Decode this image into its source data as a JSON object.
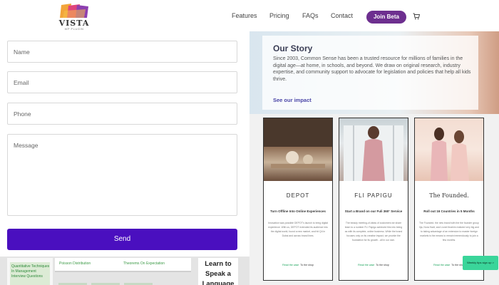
{
  "header": {
    "logo": {
      "name": "VISTA",
      "sub": "WP PLUGIN"
    },
    "nav": [
      "Features",
      "Pricing",
      "FAQs",
      "Contact"
    ],
    "cta": "Join Beta",
    "cart_icon": "cart-icon"
  },
  "form": {
    "fields": [
      "Name",
      "Email",
      "Phone",
      "Message"
    ],
    "submit": "Send"
  },
  "story": {
    "title": "Our Story",
    "body": "Since 2003, Common Sense has been a trusted resource for millions of families in the digital age—at home, in schools, and beyond. We draw on original research, industry expertise, and community support to advocate for legislation and policies that help all kids thrive.",
    "link": "See our impact"
  },
  "cards": [
    {
      "brand": "DEPOT",
      "headline": "Turn Offline Into Online Experiences",
      "body": "Innovation was possible DEPOT's launch to bring digital experience. With us, DEPOT extended its audience into the digital world, found a new market, and hit Q4 in Dubai and across brand lines.",
      "link1": "Read the case",
      "link2": "To the shop"
    },
    {
      "brand": "FLI PAPIGU",
      "headline": "Start a Brand on our Fuli 360° Service",
      "body": "The beauty meeting-of-ideas of customers we share team to a number FLI Papigu achieved this into being as with its complete, online business. While the brand focuses only on its creative impact, we provide the foundation for its growth - all in our own.",
      "link1": "Read the case",
      "link2": "To the shop"
    },
    {
      "brand": "The Founded.",
      "headline": "Roll out 16 Countries in 5 Months",
      "body": "The Founded. the new brand with the the founder group Ilja, Nora Hadt, and Lionel Ibrahim realized very big and to taking advantage of an extension to master foreign markets is the means to remain tremendously to join a few months.",
      "link1": "Read the case",
      "link2": "To the shop"
    }
  ],
  "signup_chip": "Weekly tips sign up >",
  "bottom": {
    "tile_a": "Quantitative Techniques In Management Interview Questions",
    "tile_b1": "Poisson Distribution",
    "tile_b2": "Theorems On Expectation",
    "tile_c": "Learn to Speak a Language"
  }
}
